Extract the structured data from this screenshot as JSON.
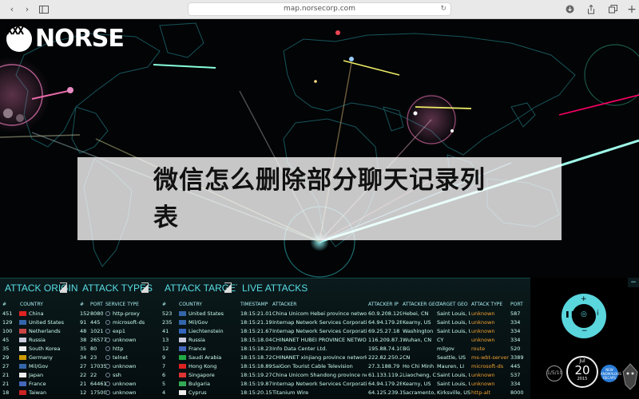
{
  "browser": {
    "url": "map.norsecorp.com"
  },
  "logo": {
    "name": "NORSE"
  },
  "overlay": {
    "text": "微信怎么删除部分聊天记录列表"
  },
  "panels": {
    "origins": {
      "title": "ATTACK ORIGINS",
      "headers": [
        "#",
        "COUNTRY"
      ],
      "rows": [
        {
          "count": "451",
          "country": "China",
          "flag": "#d22"
        },
        {
          "count": "129",
          "country": "United States",
          "flag": "#36a"
        },
        {
          "count": "100",
          "country": "Netherlands",
          "flag": "#c44"
        },
        {
          "count": "45",
          "country": "Russia",
          "flag": "#ccd"
        },
        {
          "count": "35",
          "country": "South Korea",
          "flag": "#eee"
        },
        {
          "count": "29",
          "country": "Germany",
          "flag": "#c90"
        },
        {
          "count": "27",
          "country": "Mil/Gov",
          "flag": "#36a"
        },
        {
          "count": "21",
          "country": "Japan",
          "flag": "#eee"
        },
        {
          "count": "21",
          "country": "France",
          "flag": "#46b"
        },
        {
          "count": "18",
          "country": "Taiwan",
          "flag": "#c22"
        }
      ]
    },
    "types": {
      "title": "ATTACK TYPES",
      "headers": [
        "#",
        "PORT",
        "SERVICE TYPE"
      ],
      "rows": [
        {
          "count": "152",
          "port": "8080",
          "service": "http-proxy"
        },
        {
          "count": "91",
          "port": "445",
          "service": "microsoft-ds"
        },
        {
          "count": "48",
          "port": "1021",
          "service": "exp1"
        },
        {
          "count": "38",
          "port": "26577",
          "service": "unknown"
        },
        {
          "count": "35",
          "port": "80",
          "service": "http"
        },
        {
          "count": "34",
          "port": "23",
          "service": "telnet"
        },
        {
          "count": "27",
          "port": "17035",
          "service": "unknown"
        },
        {
          "count": "22",
          "port": "22",
          "service": "ssh"
        },
        {
          "count": "21",
          "port": "64461",
          "service": "unknown"
        },
        {
          "count": "12",
          "port": "17500",
          "service": "unknown"
        }
      ]
    },
    "targets": {
      "title": "ATTACK TARGETS",
      "headers": [
        "#",
        "COUNTRY"
      ],
      "rows": [
        {
          "count": "523",
          "country": "United States",
          "flag": "#36a"
        },
        {
          "count": "235",
          "country": "Mil/Gov",
          "flag": "#36a"
        },
        {
          "count": "41",
          "country": "Liechtenstein",
          "flag": "#36b"
        },
        {
          "count": "13",
          "country": "Russia",
          "flag": "#ccd"
        },
        {
          "count": "12",
          "country": "France",
          "flag": "#46b"
        },
        {
          "count": "9",
          "country": "Saudi Arabia",
          "flag": "#2a4"
        },
        {
          "count": "7",
          "country": "Hong Kong",
          "flag": "#d22"
        },
        {
          "count": "6",
          "country": "Singapore",
          "flag": "#d33"
        },
        {
          "count": "5",
          "country": "Bulgaria",
          "flag": "#3a5"
        },
        {
          "count": "4",
          "country": "Cyprus",
          "flag": "#eee"
        }
      ]
    },
    "live": {
      "title": "LIVE ATTACKS",
      "headers": [
        "TIMESTAMP",
        "ATTACKER",
        "ATTACKER IP",
        "ATTACKER GEO",
        "TARGET GEO",
        "ATTACK TYPE",
        "PORT"
      ],
      "rows": [
        {
          "ts": "18:15:21.019",
          "attacker": "China Unicom Hebei province network",
          "ip": "60.9.208.129",
          "ageo": "Hebei, CN",
          "tgeo": "Saint Louis, US",
          "type": "unknown",
          "port": "587"
        },
        {
          "ts": "18:15:21.196",
          "attacker": "Internap Network Services Corporation",
          "ip": "64.94.179.28",
          "ageo": "Kearny, US",
          "tgeo": "Saint Louis, US",
          "type": "unknown",
          "port": "334"
        },
        {
          "ts": "18:15:21.676",
          "attacker": "Internap Network Services Corporation",
          "ip": "69.25.27.18",
          "ageo": "Washington",
          "tgeo": "Saint Louis, US",
          "type": "unknown",
          "port": "334"
        },
        {
          "ts": "18:15:18.047",
          "attacker": "CHINANET HUBEI PROVINCE NETWORK",
          "ip": "116.209.87.161",
          "ageo": "Wuhan, CN",
          "tgeo": "CY",
          "type": "unknown",
          "port": "334"
        },
        {
          "ts": "18:15:18.232",
          "attacker": "Info Data Center Ltd.",
          "ip": "195.88.74.101",
          "ageo": "BG",
          "tgeo": "milgov",
          "type": "route",
          "port": "520"
        },
        {
          "ts": "18:15:18.726",
          "attacker": "CHINANET xinjiang province network",
          "ip": "222.82.250.210",
          "ageo": "CN",
          "tgeo": "Seattle, US",
          "type": "ms-wbt-server",
          "port": "3389"
        },
        {
          "ts": "18:15:18.890",
          "attacker": "SaiGon Tourist Cable Television",
          "ip": "27.3.188.79",
          "ageo": "Ho Chi Minh ...",
          "tgeo": "Mauren, LI",
          "type": "microsoft-ds",
          "port": "445"
        },
        {
          "ts": "18:15:19.274",
          "attacker": "China Unicom Shandong province network",
          "ip": "61.133.119.229",
          "ageo": "Liaocheng, CN",
          "tgeo": "Saint Louis, US",
          "type": "unknown",
          "port": "537"
        },
        {
          "ts": "18:15:19.876",
          "attacker": "Internap Network Services Corporation",
          "ip": "64.94.179.28",
          "ageo": "Kearny, US",
          "tgeo": "Saint Louis, US",
          "type": "unknown",
          "port": "334"
        },
        {
          "ts": "18:15:20.150",
          "attacker": "Titanium Wire",
          "ip": "64.125.239.178",
          "ageo": "Sacramento, ...",
          "tgeo": "Kirksville, US",
          "type": "http-alt",
          "port": "8000"
        }
      ]
    }
  },
  "controls": {
    "speed": "1/5/10",
    "month": "Jul",
    "day": "20",
    "year": "2015",
    "badge": "NEW ANOMALOUS RECAPS"
  }
}
